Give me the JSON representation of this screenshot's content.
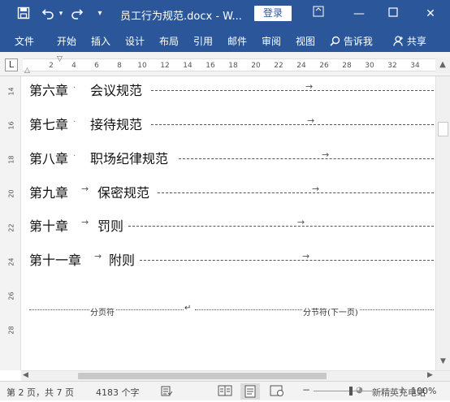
{
  "titlebar": {
    "doc_title": "员工行为规范.docx",
    "app_suffix": "- W...",
    "login_label": "登录",
    "icons": [
      "save-icon",
      "undo-icon",
      "redo-icon",
      "customize-icon"
    ],
    "bg_color": "#2b579a"
  },
  "ribbon": {
    "tabs": [
      "文件",
      "开始",
      "插入",
      "设计",
      "布局",
      "引用",
      "邮件",
      "审阅",
      "视图"
    ],
    "tell_me": "告诉我",
    "share": "共享"
  },
  "ruler": {
    "corner": "L",
    "ticks": [
      "2",
      "4",
      "6",
      "8",
      "10",
      "12",
      "14",
      "16",
      "18",
      "20",
      "22",
      "24",
      "26",
      "28",
      "30",
      "32",
      "34"
    ]
  },
  "vruler": {
    "ticks": [
      "14",
      "16",
      "18",
      "20",
      "22",
      "24",
      "26",
      "28"
    ]
  },
  "document": {
    "chapters": [
      {
        "label": "第六章",
        "title": "会议规范"
      },
      {
        "label": "第七章",
        "title": "接待规范"
      },
      {
        "label": "第八章",
        "title": "职场纪律规范"
      },
      {
        "label": "第九章",
        "title": "保密规范"
      },
      {
        "label": "第十章",
        "title": "罚则"
      },
      {
        "label": "第十一章",
        "title": "附则"
      }
    ],
    "page_break": "分页符",
    "section_break": "分节符(下一页)",
    "paragraph_mark": "↵"
  },
  "statusbar": {
    "page_info": "第 2 页，共 7 页",
    "word_count": "4183 个字",
    "watermark": "新精英充电站",
    "zoom": "100%"
  }
}
